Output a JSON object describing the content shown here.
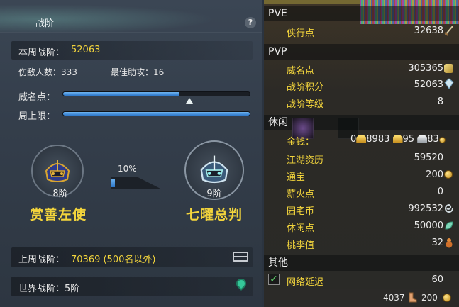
{
  "left_panel": {
    "title": "战阶",
    "help_label": "?",
    "weekly_rank_label": "本周战阶：",
    "weekly_rank_value": "52063",
    "enemies_label": "伤敌人数：333",
    "assists_label": "最佳助攻：16",
    "fame_label": "威名点：",
    "fame_progress": 0.62,
    "cap_label": "周上限：",
    "cap_progress": 1.0,
    "current_rank": {
      "level": "8阶",
      "name": "赏善左使"
    },
    "next_rank": {
      "level": "9阶",
      "name": "七曜总判"
    },
    "upgrade_percent_label": "10%",
    "upgrade_progress": 0.1,
    "last_week_label": "上周战阶：",
    "last_week_value": "70369 (500名以外)",
    "world_rank_label": "世界战阶：5阶"
  },
  "right_panel": {
    "pve": {
      "header": "PVE",
      "rows": [
        {
          "label": "侠行点",
          "value": "32638",
          "icon": "sword-icon"
        }
      ]
    },
    "pvp": {
      "header": "PVP",
      "rows": [
        {
          "label": "威名点",
          "value": "305365",
          "icon": "fame-token-icon"
        },
        {
          "label": "战阶积分",
          "value": "52063",
          "icon": "crystal-icon"
        },
        {
          "label": "战阶等级",
          "value": "8",
          "icon": ""
        }
      ]
    },
    "leisure": {
      "header": "休闲",
      "money_label": "金钱：",
      "money_parts": [
        "0",
        "8983",
        "95",
        "83"
      ],
      "rows": [
        {
          "label": "江湖资历",
          "value": "59520",
          "icon": ""
        },
        {
          "label": "通宝",
          "value": "200",
          "icon": "coin-icon"
        },
        {
          "label": "薪火点",
          "value": "0",
          "icon": ""
        },
        {
          "label": "园宅币",
          "value": "992532",
          "icon": "swirl-icon"
        },
        {
          "label": "休闲点",
          "value": "50000",
          "icon": "leaf-icon"
        },
        {
          "label": "桃李值",
          "value": "32",
          "icon": "gourd-icon"
        }
      ]
    },
    "other": {
      "header": "其他",
      "latency_label": "网络延迟",
      "latency_value": "60",
      "latency_checked": true
    },
    "status_bar": {
      "left_value": "4037",
      "right_value": "200"
    }
  },
  "colors": {
    "accent_gold": "#f2d43c",
    "bar_blue": "#3a8ee0",
    "left_bg": "#343e4b",
    "right_bg": "#2a2a27"
  }
}
